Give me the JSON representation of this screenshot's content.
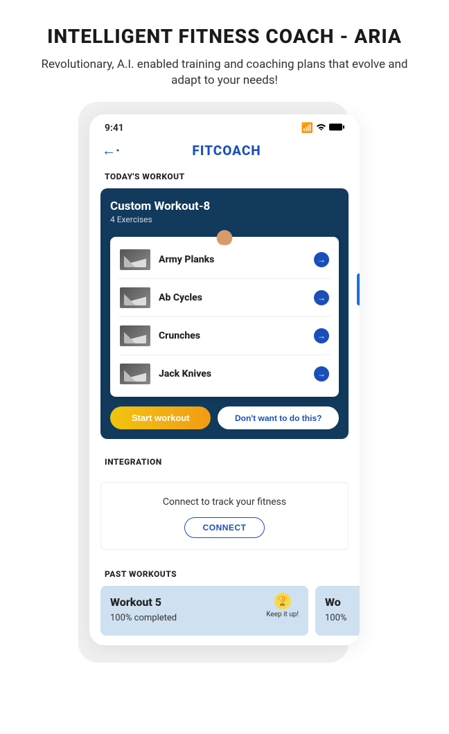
{
  "headline": "INTELLIGENT FITNESS COACH - ARIA",
  "subheadline": "Revolutionary, A.I. enabled training and coaching plans that evolve and adapt to your needs!",
  "status": {
    "time": "9:41"
  },
  "app_title": "FITCOACH",
  "sections": {
    "today": "TODAY'S WORKOUT",
    "integration": "INTEGRATION",
    "past": "PAST WORKOUTS"
  },
  "workout": {
    "title": "Custom Workout-8",
    "subtitle": "4 Exercises",
    "exercises": [
      {
        "name": "Army Planks"
      },
      {
        "name": "Ab Cycles"
      },
      {
        "name": "Crunches"
      },
      {
        "name": "Jack Knives"
      }
    ],
    "start_label": "Start workout",
    "skip_label": "Don't want to do this?"
  },
  "integration": {
    "text": "Connect to track your fitness",
    "button": "CONNECT"
  },
  "past": [
    {
      "title": "Workout 5",
      "completion": "100% completed",
      "badge": "Keep it up!"
    },
    {
      "title": "Wo",
      "completion": "100%",
      "badge": ""
    }
  ]
}
